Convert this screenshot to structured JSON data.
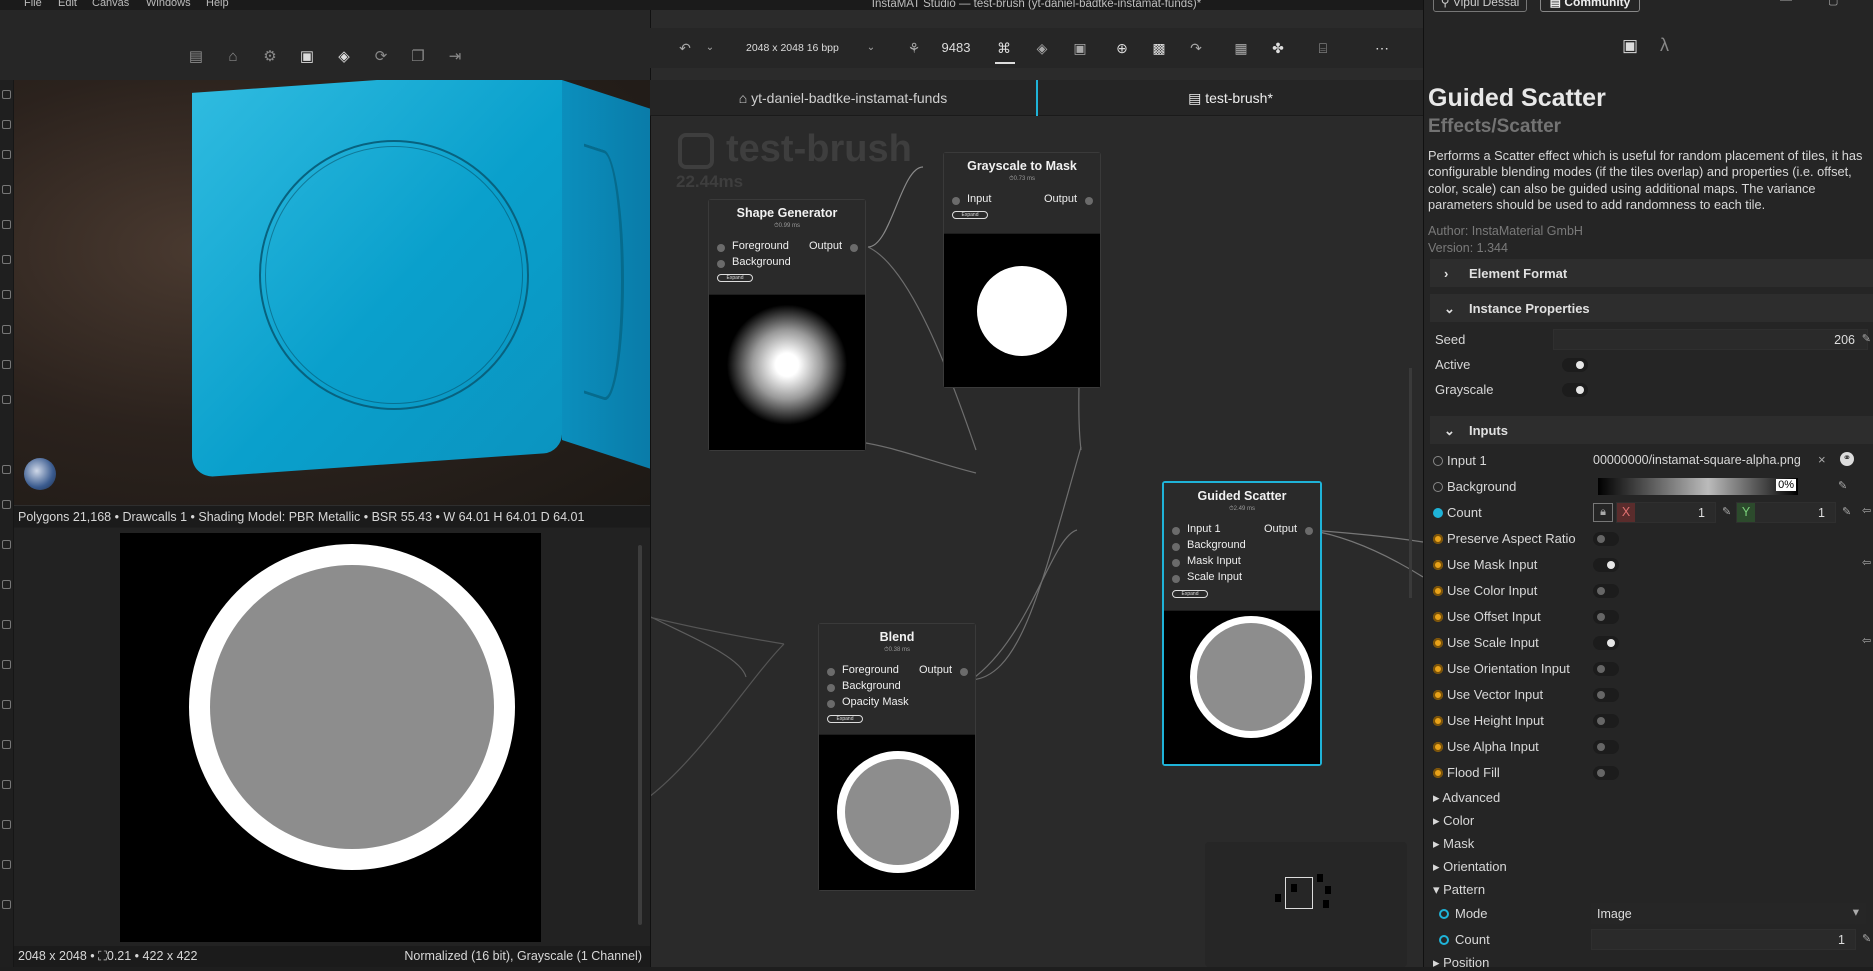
{
  "menu": {
    "file": "File",
    "edit": "Edit",
    "canvas": "Canvas",
    "windows": "Windows",
    "help": "Help"
  },
  "window_title": "InstaMAT Studio — test-brush (yt-daniel-badtke-instamat-funds)*",
  "viewport": {
    "status": "Polygons 21,168 • Drawcalls 1 • Shading Model: PBR Metallic • BSR 55.43 • W 64.01 H 64.01 D 64.01"
  },
  "view2d": {
    "status_left": "2048 x 2048 • ⛶0.21 • 422 x 422",
    "status_right": "Normalized (16 bit), Grayscale (1 Channel)"
  },
  "graph_toolbar": {
    "resolution": "2048 x 2048 16 bpp",
    "seed": "9483"
  },
  "tabs": [
    {
      "label": "yt-daniel-badtke-instamat-funds"
    },
    {
      "label": "test-brush*"
    }
  ],
  "graph": {
    "title": "test-brush",
    "time": "22.44ms",
    "nodes": {
      "shape": {
        "title": "Shape Generator",
        "time": "⏱0.99 ms",
        "in1": "Foreground",
        "in2": "Background",
        "out": "Output",
        "expand": "Expand"
      },
      "g2m": {
        "title": "Grayscale to Mask",
        "time": "⏱0.73 ms",
        "in1": "Input",
        "out": "Output",
        "expand": "Expand"
      },
      "blend": {
        "title": "Blend",
        "time": "⏱0.38 ms",
        "in1": "Foreground",
        "in2": "Background",
        "in3": "Opacity Mask",
        "out": "Output",
        "expand": "Expand"
      },
      "scatter": {
        "title": "Guided Scatter",
        "time": "⏱2.49 ms",
        "in1": "Input 1",
        "in2": "Background",
        "in3": "Mask Input",
        "in4": "Scale Input",
        "out": "Output",
        "expand": "Expand"
      }
    }
  },
  "panel": {
    "user": "Vipul Dessai",
    "community": "Community",
    "title": "Guided Scatter",
    "subtitle": "Effects/Scatter",
    "description": "Performs a Scatter effect which is useful for random placement of tiles, it has configurable blending modes (if the tiles overlap) and properties (i.e. offset, color, scale) can also be guided using additional maps. The variance parameters should be used to add randomness to each tile.",
    "author": "Author: InstaMaterial GmbH",
    "version": "Version: 1.344",
    "sections": {
      "element_format": "Element Format",
      "instance_properties": "Instance Properties",
      "inputs": "Inputs"
    },
    "seed": {
      "label": "Seed",
      "value": "206"
    },
    "active": "Active",
    "grayscale": "Grayscale",
    "input1": {
      "label": "Input 1",
      "value": "00000000/instamat-square-alpha.png"
    },
    "background": {
      "label": "Background",
      "value": "0%"
    },
    "count": {
      "label": "Count",
      "x_label": "X",
      "x": "1",
      "y_label": "Y",
      "y": "1"
    },
    "toggles": [
      {
        "label": "Preserve Aspect Ratio",
        "on": false
      },
      {
        "label": "Use Mask Input",
        "on": true
      },
      {
        "label": "Use Color Input",
        "on": false
      },
      {
        "label": "Use Offset Input",
        "on": false
      },
      {
        "label": "Use Scale Input",
        "on": true
      },
      {
        "label": "Use Orientation Input",
        "on": false
      },
      {
        "label": "Use Vector Input",
        "on": false
      },
      {
        "label": "Use Height Input",
        "on": false
      },
      {
        "label": "Use Alpha Input",
        "on": false
      },
      {
        "label": "Flood Fill",
        "on": false
      }
    ],
    "groups": {
      "advanced": "Advanced",
      "color": "Color",
      "mask": "Mask",
      "orientation": "Orientation",
      "pattern": "Pattern",
      "position": "Position"
    },
    "mode": {
      "label": "Mode",
      "value": "Image"
    },
    "pattern_count": {
      "label": "Count",
      "value": "1"
    }
  },
  "colors": {
    "accent": "#1fb3d8",
    "orange": "#e8a21a",
    "cube": "#0aa6d4"
  }
}
